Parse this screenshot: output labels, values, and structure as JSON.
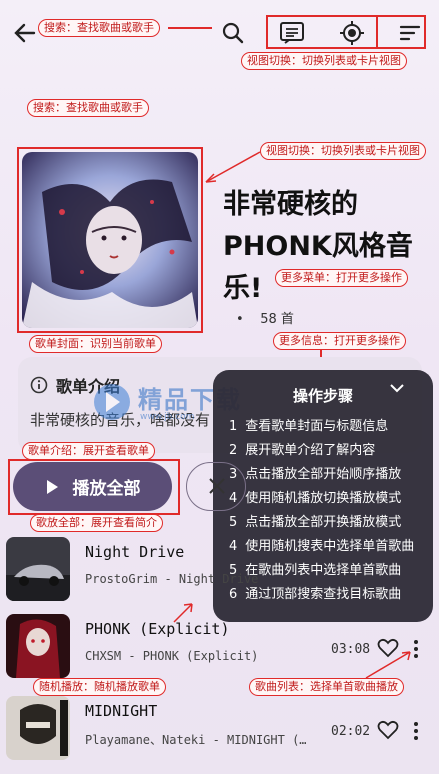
{
  "annotations": {
    "top_search": "搜索：查找歌曲或歌手",
    "top_view": "视图切换：切换列表或卡片视图",
    "left_search": "搜索：查找歌曲或歌手",
    "right_view": "视图切换：切换列表或卡片视图",
    "more_menu": "更多菜单：打开更多操作",
    "cover": "歌单封面：识别当前歌单",
    "more_info": "更多信息：打开更多操作",
    "intro": "歌单介绍：展开查看歌单",
    "play_all": "歌放全部：展开查看简介",
    "shuffle": "随机播放：随机播放歌单",
    "song_list": "歌曲列表：选择单首歌曲播放"
  },
  "playlist": {
    "title": "非常硬核的PHONK风格音乐!",
    "bullet": "•",
    "count": "58 首"
  },
  "intro": {
    "heading": "歌单介绍",
    "text": "非常硬核的音乐，啥都没有"
  },
  "actions": {
    "play_all_label": "播放全部"
  },
  "watermark": {
    "text": "精品下载",
    "url": "www.jb.com"
  },
  "steps": {
    "title": "操作步骤",
    "items": [
      {
        "num": "1",
        "text": "查看歌单封面与标题信息"
      },
      {
        "num": "2",
        "text": "展开歌单介绍了解内容"
      },
      {
        "num": "3",
        "text": "点击播放全部开始顺序播放"
      },
      {
        "num": "4",
        "text": "使用随机播放切换播放模式"
      },
      {
        "num": "5",
        "text": "点击播放全部开换播放模式"
      },
      {
        "num": "4",
        "text": "使用随机搜表中选择单首歌曲"
      },
      {
        "num": "5",
        "text": "在歌曲列表中选择单首歌曲"
      },
      {
        "num": "6",
        "text": "通过顶部搜索查找目标歌曲"
      }
    ]
  },
  "songs": [
    {
      "name": "Night Drive",
      "artist": "ProstoGrim - Night Drive",
      "duration": ""
    },
    {
      "name": "PHONK (Explicit)",
      "artist": "CHXSM - PHONK (Explicit)",
      "duration": "03:08"
    },
    {
      "name": "MIDNIGHT",
      "artist": "Playamane、Nateki - MIDNIGHT (…",
      "duration": "02:02"
    }
  ],
  "colors": {
    "accent": "#5b4e77",
    "annotation_red": "#e02a2a",
    "overlay": "#2c2834"
  }
}
